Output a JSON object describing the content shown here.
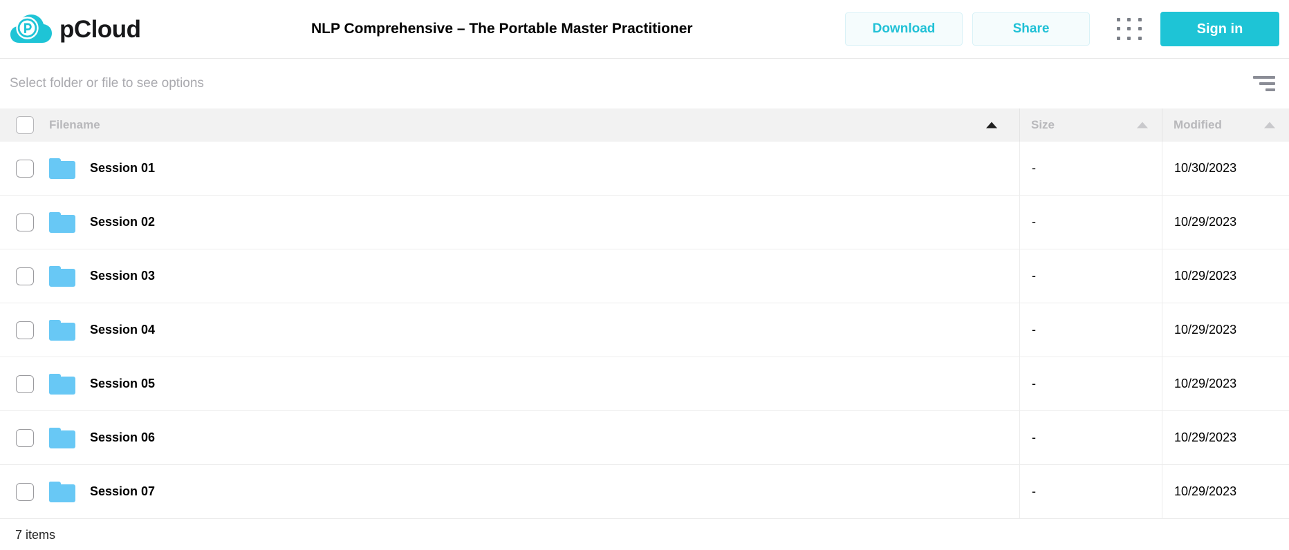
{
  "brand": {
    "name": "pCloud",
    "logo_icon": "pcloud-cloud-logo",
    "accent": "#1ec4d6"
  },
  "header": {
    "title": "NLP Comprehensive – The Portable Master Practitioner",
    "download_label": "Download",
    "share_label": "Share",
    "apps_icon": "grid-apps-icon",
    "signin_label": "Sign in"
  },
  "toolbar": {
    "hint": "Select folder or file to see options",
    "sort_icon": "sort-filter-icon"
  },
  "table": {
    "select_all_checked": false,
    "columns": [
      {
        "key": "filename",
        "label": "Filename",
        "sort": "asc",
        "sort_active": true
      },
      {
        "key": "size",
        "label": "Size",
        "sort": "asc",
        "sort_active": false
      },
      {
        "key": "modified",
        "label": "Modified",
        "sort": "asc",
        "sort_active": false
      }
    ],
    "rows": [
      {
        "icon": "folder-icon",
        "filename": "Session 01",
        "size": "-",
        "modified": "10/30/2023",
        "checked": false
      },
      {
        "icon": "folder-icon",
        "filename": "Session 02",
        "size": "-",
        "modified": "10/29/2023",
        "checked": false
      },
      {
        "icon": "folder-icon",
        "filename": "Session 03",
        "size": "-",
        "modified": "10/29/2023",
        "checked": false
      },
      {
        "icon": "folder-icon",
        "filename": "Session 04",
        "size": "-",
        "modified": "10/29/2023",
        "checked": false
      },
      {
        "icon": "folder-icon",
        "filename": "Session 05",
        "size": "-",
        "modified": "10/29/2023",
        "checked": false
      },
      {
        "icon": "folder-icon",
        "filename": "Session 06",
        "size": "-",
        "modified": "10/29/2023",
        "checked": false
      },
      {
        "icon": "folder-icon",
        "filename": "Session 07",
        "size": "-",
        "modified": "10/29/2023",
        "checked": false
      }
    ]
  },
  "footer": {
    "item_count_label": "7 items"
  }
}
